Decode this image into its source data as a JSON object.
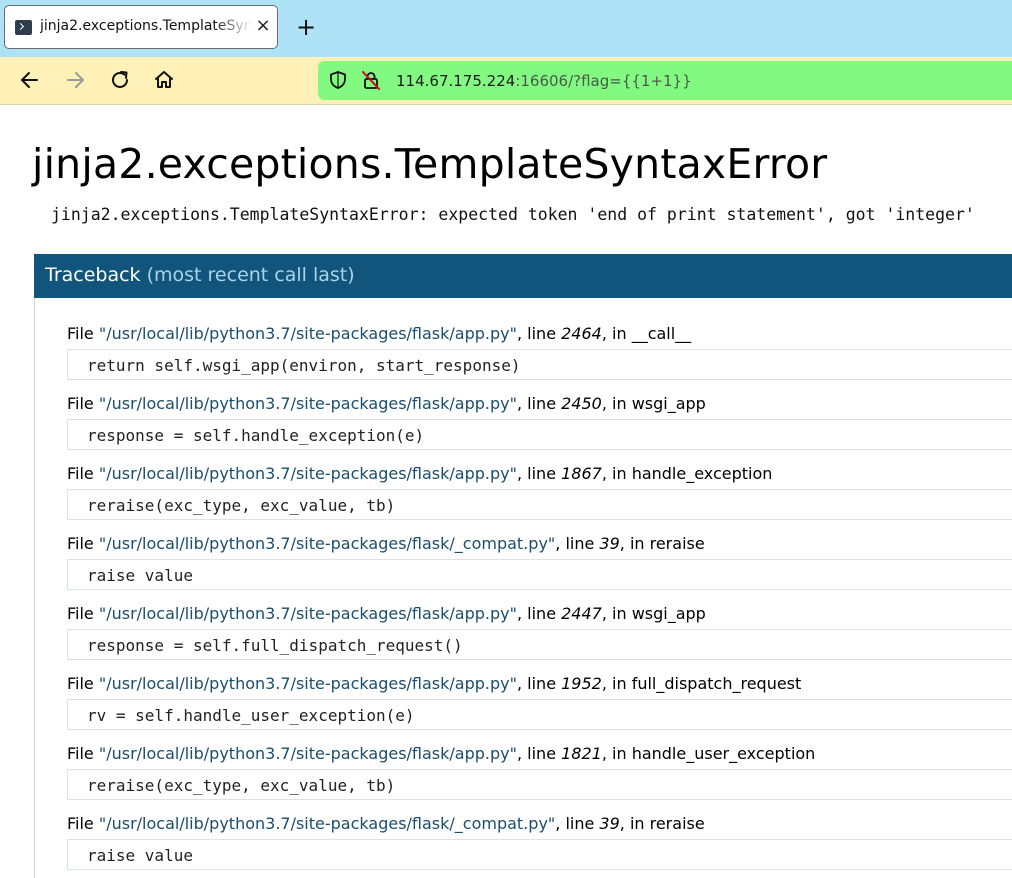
{
  "browser": {
    "tab": {
      "title": "jinja2.exceptions.TemplateSyntaxError",
      "close_icon": "×"
    },
    "new_tab_icon": "+",
    "url": {
      "host": "114.67.175.224",
      "rest": ":16606/?flag={{1+1}}"
    }
  },
  "page": {
    "title": "jinja2.exceptions.TemplateSyntaxError",
    "error_message": "jinja2.exceptions.TemplateSyntaxError: expected token 'end of print statement', got 'integer'",
    "traceback_label": "Traceback",
    "traceback_hint": "(most recent call last)"
  },
  "frames": [
    {
      "file": "\"/usr/local/lib/python3.7/site-packages/flask/app.py\"",
      "line": "2464",
      "func": "__call__",
      "code": "return self.wsgi_app(environ, start_response)"
    },
    {
      "file": "\"/usr/local/lib/python3.7/site-packages/flask/app.py\"",
      "line": "2450",
      "func": "wsgi_app",
      "code": "response = self.handle_exception(e)"
    },
    {
      "file": "\"/usr/local/lib/python3.7/site-packages/flask/app.py\"",
      "line": "1867",
      "func": "handle_exception",
      "code": "reraise(exc_type, exc_value, tb)"
    },
    {
      "file": "\"/usr/local/lib/python3.7/site-packages/flask/_compat.py\"",
      "line": "39",
      "func": "reraise",
      "code": "raise value"
    },
    {
      "file": "\"/usr/local/lib/python3.7/site-packages/flask/app.py\"",
      "line": "2447",
      "func": "wsgi_app",
      "code": "response = self.full_dispatch_request()"
    },
    {
      "file": "\"/usr/local/lib/python3.7/site-packages/flask/app.py\"",
      "line": "1952",
      "func": "full_dispatch_request",
      "code": "rv = self.handle_user_exception(e)"
    },
    {
      "file": "\"/usr/local/lib/python3.7/site-packages/flask/app.py\"",
      "line": "1821",
      "func": "handle_user_exception",
      "code": "reraise(exc_type, exc_value, tb)"
    },
    {
      "file": "\"/usr/local/lib/python3.7/site-packages/flask/_compat.py\"",
      "line": "39",
      "func": "reraise",
      "code": "raise value"
    }
  ],
  "labels": {
    "file_prefix": "File ",
    "line_prefix": ", line ",
    "in_prefix": ", in "
  },
  "colors": {
    "tabbar": "#aee3f7",
    "navbar": "#fdf1b7",
    "urlbar": "#82fa82",
    "traceback_header": "#11557c"
  }
}
